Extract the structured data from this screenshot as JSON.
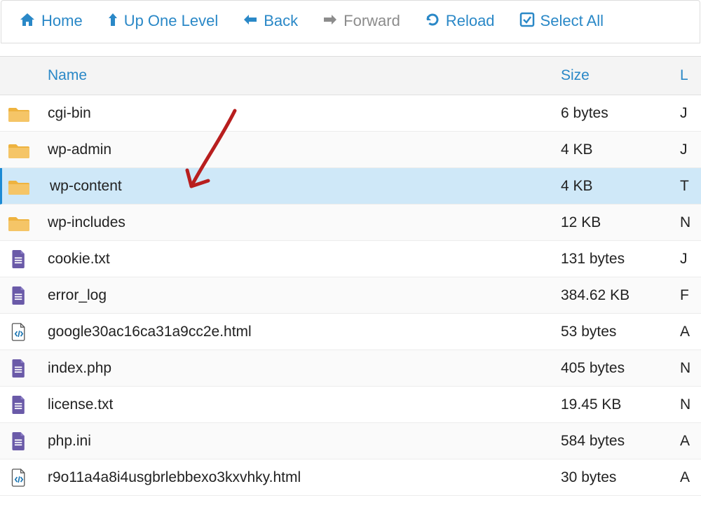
{
  "toolbar": {
    "home": "Home",
    "up": "Up One Level",
    "back": "Back",
    "forward": "Forward",
    "reload": "Reload",
    "selectAll": "Select All"
  },
  "headers": {
    "name": "Name",
    "size": "Size",
    "last": "L"
  },
  "rows": [
    {
      "icon": "folder",
      "name": "cgi-bin",
      "size": "6 bytes",
      "last": "J",
      "sel": false
    },
    {
      "icon": "folder",
      "name": "wp-admin",
      "size": "4 KB",
      "last": "J",
      "sel": false
    },
    {
      "icon": "folder",
      "name": "wp-content",
      "size": "4 KB",
      "last": "T",
      "sel": true
    },
    {
      "icon": "folder",
      "name": "wp-includes",
      "size": "12 KB",
      "last": "N",
      "sel": false
    },
    {
      "icon": "doc",
      "name": "cookie.txt",
      "size": "131 bytes",
      "last": "J",
      "sel": false
    },
    {
      "icon": "doc",
      "name": "error_log",
      "size": "384.62 KB",
      "last": "F",
      "sel": false
    },
    {
      "icon": "code",
      "name": "google30ac16ca31a9cc2e.html",
      "size": "53 bytes",
      "last": "A",
      "sel": false
    },
    {
      "icon": "doc",
      "name": "index.php",
      "size": "405 bytes",
      "last": "N",
      "sel": false
    },
    {
      "icon": "doc",
      "name": "license.txt",
      "size": "19.45 KB",
      "last": "N",
      "sel": false
    },
    {
      "icon": "doc",
      "name": "php.ini",
      "size": "584 bytes",
      "last": "A",
      "sel": false
    },
    {
      "icon": "code",
      "name": "r9o11a4a8i4usgbrlebbexo3kxvhky.html",
      "size": "30 bytes",
      "last": "A",
      "sel": false
    }
  ]
}
